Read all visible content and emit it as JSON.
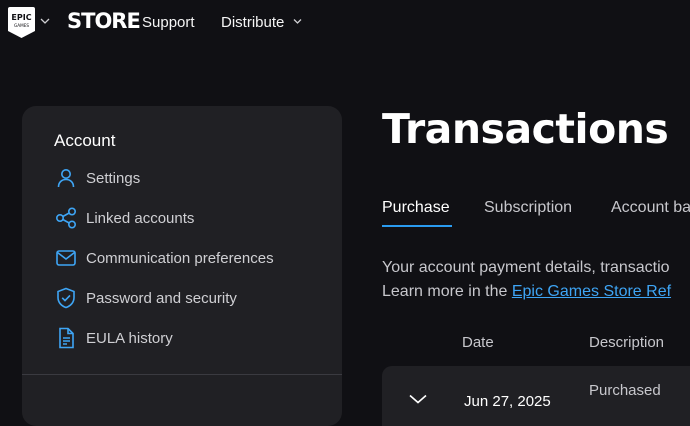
{
  "brand": {
    "logo_text": "EPIC GAMES",
    "store_label": "STORE"
  },
  "nav": {
    "support": "Support",
    "distribute": "Distribute"
  },
  "sidebar": {
    "heading": "Account",
    "items": [
      {
        "label": "Settings",
        "icon": "user-icon"
      },
      {
        "label": "Linked accounts",
        "icon": "share-nodes-icon"
      },
      {
        "label": "Communication preferences",
        "icon": "envelope-icon"
      },
      {
        "label": "Password and security",
        "icon": "shield-check-icon"
      },
      {
        "label": "EULA history",
        "icon": "document-icon"
      }
    ],
    "icon_color": "#3ea5f5"
  },
  "main": {
    "title": "Transactions",
    "tabs": [
      {
        "label": "Purchase",
        "active": true
      },
      {
        "label": "Subscription",
        "active": false
      },
      {
        "label": "Account ba",
        "active": false
      }
    ],
    "description_line1": "Your account payment details, transactio",
    "description_line2_prefix": "Learn more in the ",
    "description_link": "Epic Games Store Ref",
    "columns": {
      "date": "Date",
      "description": "Description"
    },
    "rows": [
      {
        "date": "Jun 27, 2025",
        "description": "Purchased"
      }
    ]
  },
  "colors": {
    "background": "#101014",
    "panel": "#202024",
    "accent": "#2a9bf0"
  }
}
